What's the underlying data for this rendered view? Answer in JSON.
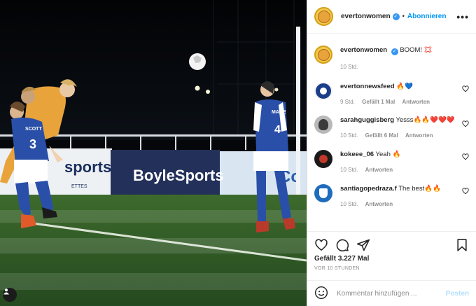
{
  "post": {
    "username": "evertonwomen",
    "follow_label": "Abonnieren",
    "separator": "•",
    "more": "•••",
    "caption_user": "evertonwomen",
    "caption_text": "BOOM! 💢",
    "caption_time": "10 Std."
  },
  "comments": [
    {
      "user": "evertonnewsfeed",
      "text": "🔥💙",
      "time": "9 Std.",
      "likes": "Gefällt 1 Mal",
      "reply": "Antworten"
    },
    {
      "user": "sarahguggisberg",
      "text": "Yesss🔥🔥❤️❤️❤️",
      "time": "10 Std.",
      "likes": "Gefällt 6 Mal",
      "reply": "Antworten"
    },
    {
      "user": "kokeee_06",
      "text": "Yeah 🔥",
      "time": "10 Std.",
      "likes": "",
      "reply": "Antworten"
    },
    {
      "user": "santiagopedraza.f",
      "text": "The best🔥🔥",
      "time": "10 Std.",
      "likes": "",
      "reply": "Antworten"
    }
  ],
  "footer": {
    "likes": "Gefällt 3.227 Mal",
    "timestamp": "VOR 10 STUNDEN",
    "comment_placeholder": "Kommentar hinzufügen ...",
    "post_label": "Posten"
  },
  "photo": {
    "board_sports": "sports",
    "board_sports_sub": "ETTES",
    "board_boyle": "BoyleSports",
    "board_co": "Co",
    "shirt_left_name": "SCOTT",
    "shirt_left_number": "3",
    "shirt_right_name": "MACE",
    "shirt_right_number": "4"
  },
  "colors": {
    "accent": "#0095f6",
    "pitch": "#2e5e2a",
    "kit_blue": "#2a4fa8",
    "keeper": "#e8a33b"
  }
}
